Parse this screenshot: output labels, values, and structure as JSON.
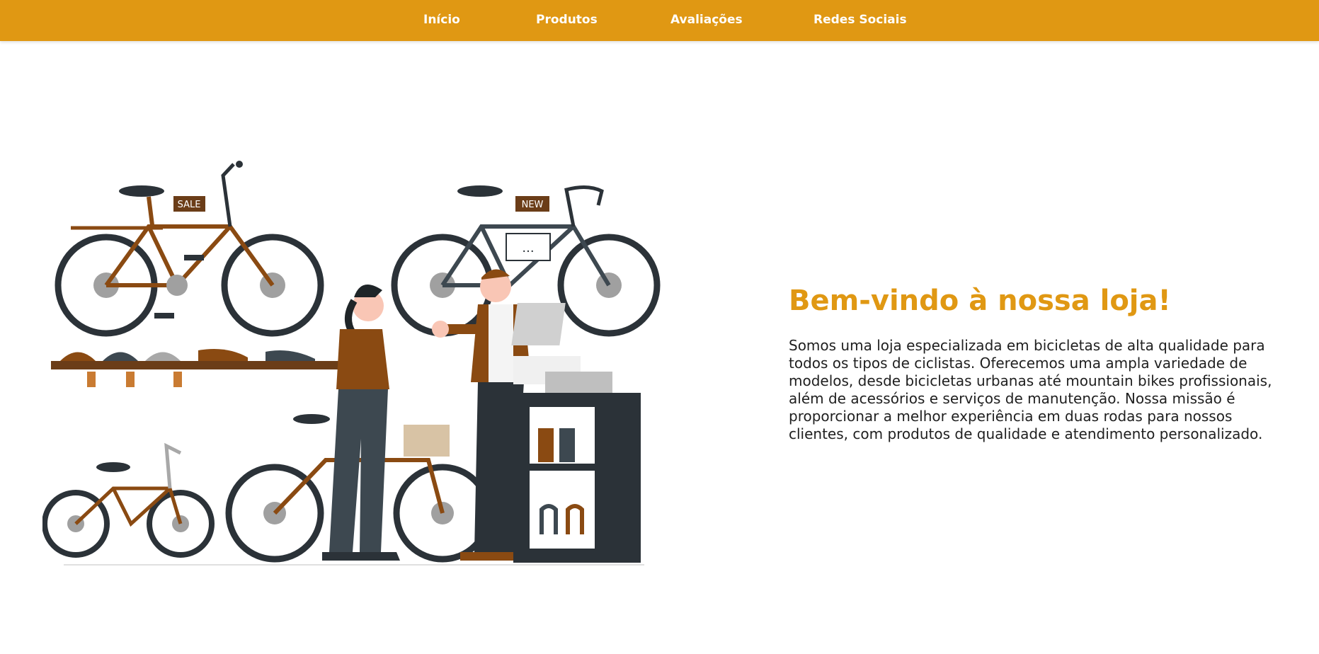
{
  "nav": {
    "items": [
      {
        "label": "Início"
      },
      {
        "label": "Produtos"
      },
      {
        "label": "Avaliações"
      },
      {
        "label": "Redes Sociais"
      }
    ]
  },
  "hero": {
    "title": "Bem-vindo à nossa loja!",
    "text": "Somos uma loja especializada em bicicletas de alta qualidade para todos os tipos de ciclistas. Oferecemos uma ampla variedade de modelos, desde bicicletas urbanas até mountain bikes profissionais, além de acessórios e serviços de manutenção. Nossa missão é proporcionar a melhor experiência em duas rodas para nossos clientes, com produtos de qualidade e atendimento personalizado."
  },
  "illustration": {
    "tag_sale": "SALE",
    "tag_new": "NEW",
    "speech": "..."
  },
  "colors": {
    "brand": "#e09813",
    "bike_brown": "#8a4a12",
    "bike_dark": "#2b3238",
    "wheel_gray": "#a0a0a0"
  }
}
